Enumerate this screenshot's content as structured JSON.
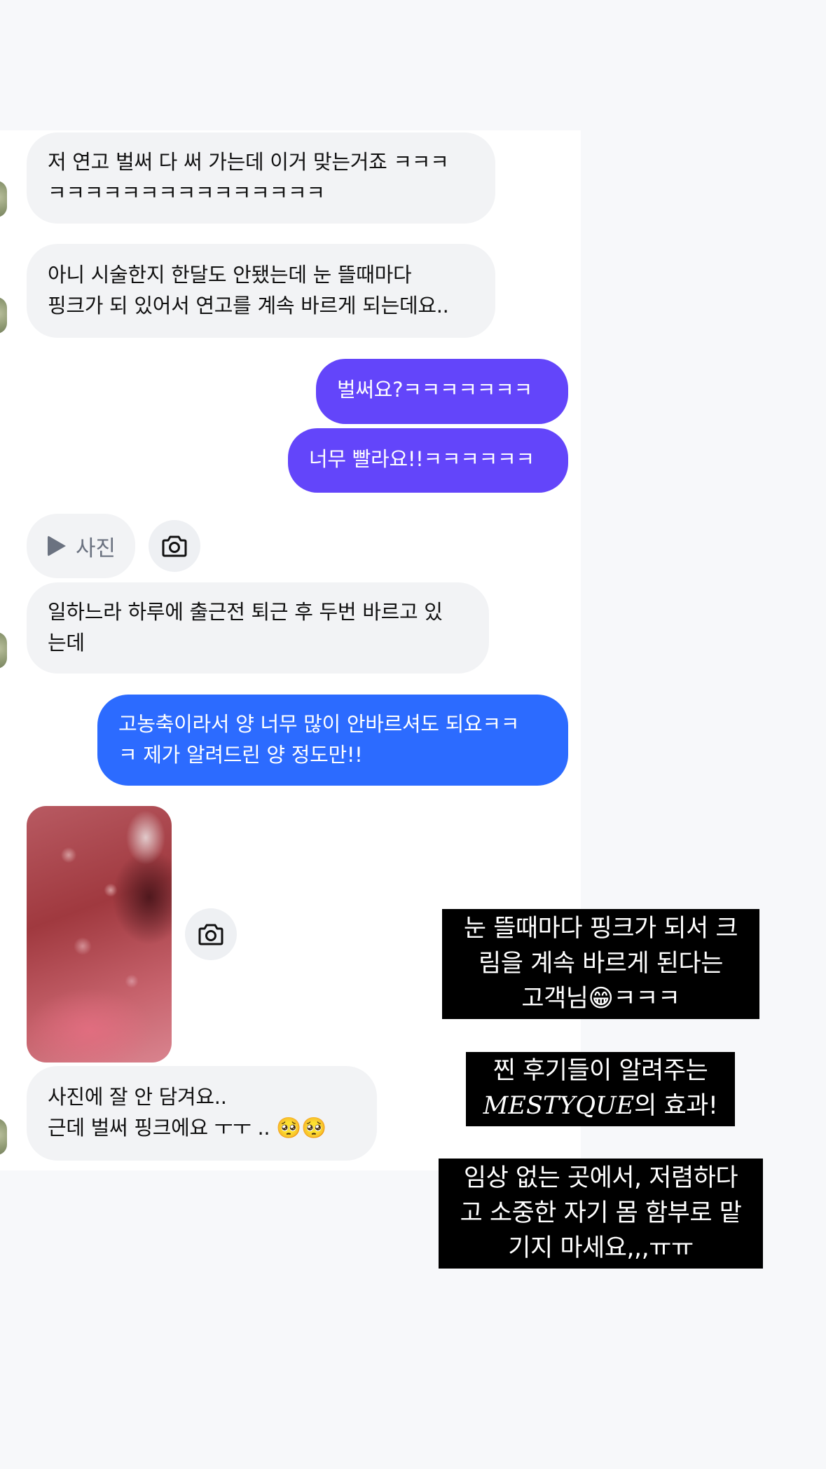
{
  "messages": {
    "m1": "저 연고 벌써 다 써 가는데 이거 맞는거죠 ㅋㅋㅋ\nㅋㅋㅋㅋㅋㅋㅋㅋㅋㅋㅋㅋㅋㅋㅋ",
    "m2": "아니 시술한지 한달도 안됐는데 눈 뜰때마다\n핑크가 되 있어서 연고를 계속 바르게 되는데요..",
    "m3": "벌써요?ㅋㅋㅋㅋㅋㅋㅋ",
    "m4": "너무 빨라요!!ㅋㅋㅋㅋㅋㅋ",
    "photo_label": "사진",
    "m5": "일하느라 하루에 출근전 퇴근 후 두번 바르고 있\n는데",
    "m6": "고농축이라서 양 너무 많이 안바르셔도 되요ㅋㅋ\nㅋ 제가 알려드린 양 정도만!!",
    "m7_line1": "사진에 잘 안 담겨요..",
    "m7_line2": "근데 벌써 핑크에요 ㅜㅜ .. 🥺🥺"
  },
  "captions": {
    "c1": "눈 뜰때마다 핑크가 되서 크\n림을 계속 바르게 된다는\n고객님😁ㅋㅋㅋ",
    "c2_line1": "찐 후기들이 알려주는",
    "c2_brand": "MESTYQUE",
    "c2_suffix": "의 효과!",
    "c3": "임상 없는 곳에서, 저렴하다\n고 소중한 자기 몸 함부로 맡\n기지 마세요,,,ㅠㅠ"
  },
  "colors": {
    "incoming": "#f2f3f5",
    "outgoing_purple": "#6345fa",
    "outgoing_blue": "#2c6bff"
  }
}
